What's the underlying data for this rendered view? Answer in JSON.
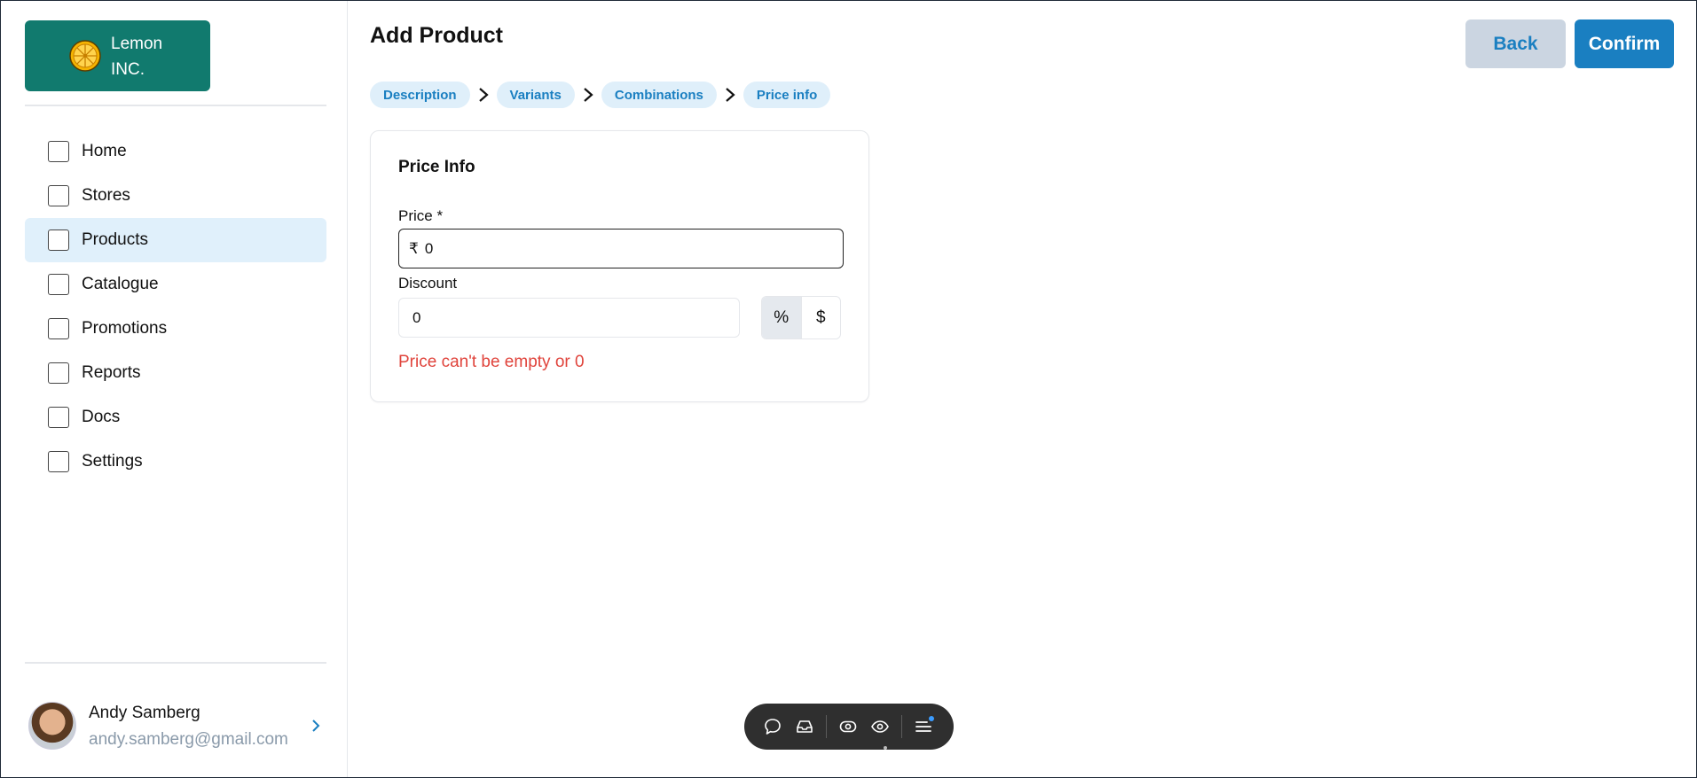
{
  "brand": {
    "name": "Lemon INC."
  },
  "sidebar": {
    "items": [
      {
        "label": "Home"
      },
      {
        "label": "Stores"
      },
      {
        "label": "Products",
        "active": true
      },
      {
        "label": "Catalogue"
      },
      {
        "label": "Promotions"
      },
      {
        "label": "Reports"
      },
      {
        "label": "Docs"
      },
      {
        "label": "Settings"
      }
    ]
  },
  "user": {
    "name": "Andy Samberg",
    "email": "andy.samberg@gmail.com"
  },
  "header": {
    "title": "Add Product",
    "back_label": "Back",
    "confirm_label": "Confirm"
  },
  "steps": [
    "Description",
    "Variants",
    "Combinations",
    "Price info"
  ],
  "card": {
    "title": "Price Info",
    "price_label": "Price *",
    "currency_symbol": "₹",
    "price_value": "0",
    "discount_label": "Discount",
    "discount_value": "0",
    "discount_types": [
      "%",
      "$"
    ],
    "selected_discount_type": "%",
    "error": "Price can't be empty or 0"
  },
  "colors": {
    "accent": "#1a7fc1",
    "brand": "#117a6e",
    "error": "#e0443c",
    "active_nav": "#e0f0fb"
  },
  "toolbar": {
    "icons": [
      "comment-icon",
      "inbox-icon",
      "eye-outline-icon",
      "eye-icon",
      "menu-icon"
    ]
  }
}
